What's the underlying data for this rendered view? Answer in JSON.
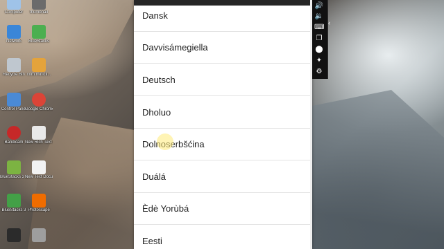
{
  "desktop": {
    "icons": [
      {
        "label": "Computer",
        "color": "#9fc3e8"
      },
      {
        "label": "thumbnail",
        "color": "#6b6b6b"
      },
      {
        "label": "Network",
        "color": "#3a86d8"
      },
      {
        "label": "BlueStacks",
        "color": "#4caf50"
      },
      {
        "label": "Recycle Bin",
        "color": "#bfc7cf"
      },
      {
        "label": "com.minicli...",
        "color": "#e4a33b"
      },
      {
        "label": "Control Panel",
        "color": "#4a8ad6"
      },
      {
        "label": "Google Chrome",
        "color": "#db4437"
      },
      {
        "label": "Bandicam",
        "color": "#c62828"
      },
      {
        "label": "New Rich Text Docum...",
        "color": "#e9e9e9"
      },
      {
        "label": "BlueStacks 3 Multi-Insta...",
        "color": "#7cb342"
      },
      {
        "label": "New Text Document",
        "color": "#f2f2f2"
      },
      {
        "label": "BlueStacks 3",
        "color": "#43a047"
      },
      {
        "label": "Photoscape",
        "color": "#ef6c00"
      },
      {
        "label": "",
        "color": "#2b2b2b"
      },
      {
        "label": "",
        "color": "#9e9e9e"
      }
    ]
  },
  "languages": [
    "Dansk",
    "Davvisámegiella",
    "Deutsch",
    "Dholuo",
    "Dolnoserbšćina",
    "Duálá",
    "Èdè Yorùbá",
    "Eesti"
  ],
  "toolbar": {
    "buttons": [
      {
        "icon": "volume-up-icon",
        "glyph": "🔊"
      },
      {
        "icon": "volume-down-icon",
        "glyph": "🔉"
      },
      {
        "icon": "keyboard-icon",
        "glyph": "⌨"
      },
      {
        "icon": "copy-icon",
        "glyph": "❐"
      },
      {
        "icon": "screenshot-icon",
        "glyph": "▣"
      },
      {
        "icon": "location-icon",
        "glyph": "⬤"
      },
      {
        "icon": "shake-icon",
        "glyph": "✦"
      },
      {
        "icon": "settings-icon",
        "glyph": "⚙"
      }
    ],
    "collapse_glyph": "‹"
  },
  "colors": {
    "panel_background": "#ffffff",
    "divider": "#e3e3e3",
    "text": "#1f1f1f",
    "toolbar_background": "#111111"
  }
}
